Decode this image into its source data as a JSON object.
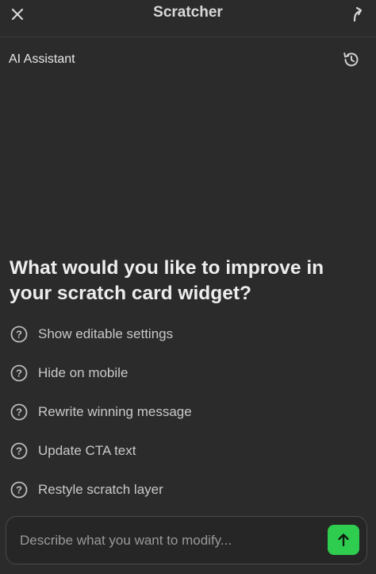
{
  "header": {
    "title": "Scratcher",
    "close_icon": "close-icon",
    "share_icon": "share-arrow-icon"
  },
  "panel": {
    "label": "AI Assistant",
    "history_icon": "history-icon"
  },
  "prompt": {
    "heading": "What would you like to improve in your scratch card widget?"
  },
  "suggestions": [
    {
      "label": "Show editable settings",
      "icon": "question-circle-icon"
    },
    {
      "label": "Hide on mobile",
      "icon": "question-circle-icon"
    },
    {
      "label": "Rewrite winning message",
      "icon": "question-circle-icon"
    },
    {
      "label": "Update CTA text",
      "icon": "question-circle-icon"
    },
    {
      "label": "Restyle scratch layer",
      "icon": "question-circle-icon"
    }
  ],
  "composer": {
    "placeholder": "Describe what you want to modify...",
    "value": "",
    "send_icon": "arrow-up-icon"
  },
  "colors": {
    "background": "#2b2b2b",
    "send_button": "#2ecc4f",
    "icon": "#cfcfcf"
  }
}
